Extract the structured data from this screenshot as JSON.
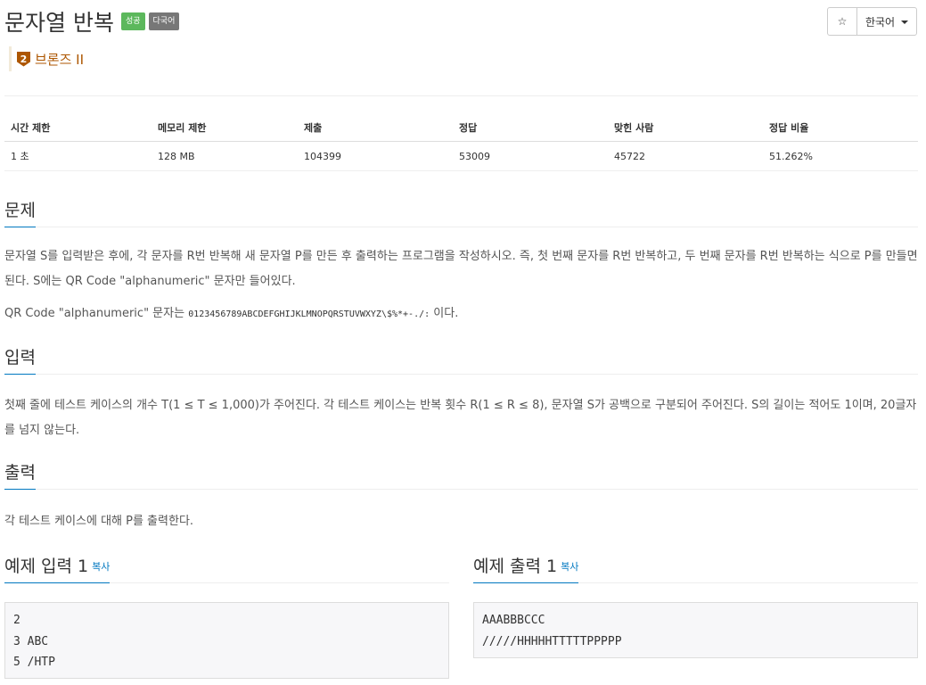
{
  "problem": {
    "title": "문자열 반복",
    "labels": {
      "status": "성공",
      "multi_lang": "다국어"
    },
    "tier": {
      "icon_text": "2",
      "name": "브론즈 II"
    }
  },
  "toolbar": {
    "star": "☆",
    "language": "한국어"
  },
  "info_table": {
    "headers": [
      "시간 제한",
      "메모리 제한",
      "제출",
      "정답",
      "맞힌 사람",
      "정답 비율"
    ],
    "values": [
      "1 초",
      "128 MB",
      "104399",
      "53009",
      "45722",
      "51.262%"
    ]
  },
  "sections": {
    "problem": {
      "heading": "문제",
      "para1": "문자열 S를 입력받은 후에, 각 문자를 R번 반복해 새 문자열 P를 만든 후 출력하는 프로그램을 작성하시오. 즉, 첫 번째 문자를 R번 반복하고, 두 번째 문자를 R번 반복하는 식으로 P를 만들면 된다. S에는 QR Code \"alphanumeric\" 문자만 들어있다.",
      "para2_prefix": "QR Code \"alphanumeric\" 문자는 ",
      "para2_code": "0123456789ABCDEFGHIJKLMNOPQRSTUVWXYZ\\$%*+-./:",
      "para2_suffix": " 이다."
    },
    "input": {
      "heading": "입력",
      "text": "첫째 줄에 테스트 케이스의 개수 T(1 ≤ T ≤ 1,000)가 주어진다. 각 테스트 케이스는 반복 횟수 R(1 ≤ R ≤ 8), 문자열 S가 공백으로 구분되어 주어진다. S의 길이는 적어도 1이며, 20글자를 넘지 않는다."
    },
    "output": {
      "heading": "출력",
      "text": "각 테스트 케이스에 대해 P를 출력한다."
    },
    "sample_input": {
      "heading": "예제 입력 1",
      "copy": "복사",
      "content": "2\n3 ABC\n5 /HTP"
    },
    "sample_output": {
      "heading": "예제 출력 1",
      "copy": "복사",
      "content": "AAABBBCCC\n/////HHHHHTTTTTPPPPP"
    }
  }
}
